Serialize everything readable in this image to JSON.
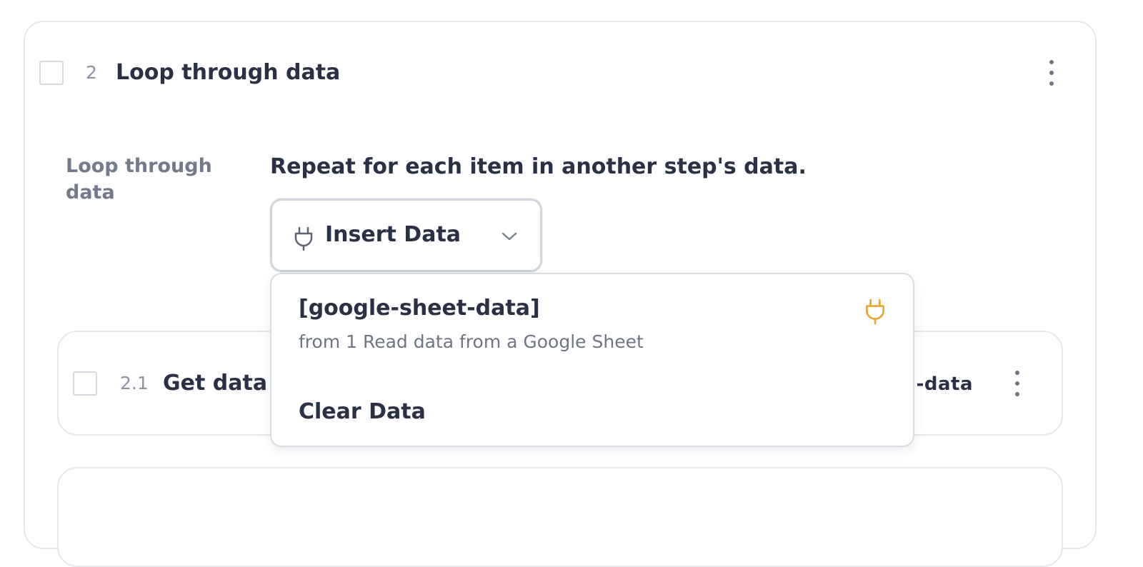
{
  "step": {
    "number": "2",
    "title": "Loop through data",
    "menu_icon": "kebab-menu-icon"
  },
  "field": {
    "label": "Loop through data",
    "description": "Repeat for each item in another step's data."
  },
  "insert_button": {
    "label": "Insert Data",
    "icon": "plug-icon",
    "chevron_icon": "chevron-down-icon"
  },
  "child_steps": [
    {
      "number": "2.1",
      "title": "Get data f",
      "suffix": "-data"
    }
  ],
  "dropdown": {
    "items": [
      {
        "title": "[google-sheet-data]",
        "subtitle": "from 1 Read data from a Google Sheet",
        "icon": "plug-icon",
        "icon_color": "#e8a530"
      }
    ],
    "clear_label": "Clear Data"
  },
  "colors": {
    "text_primary": "#2a3145",
    "text_muted": "#737a8c",
    "border": "#e6e8ee",
    "accent_plug": "#e8a530"
  }
}
